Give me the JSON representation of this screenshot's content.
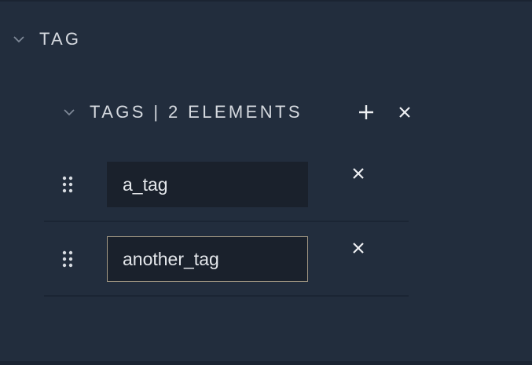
{
  "section": {
    "title": "TAG",
    "icon": "chevron-down-icon"
  },
  "tags": {
    "title": "TAGS | 2 ELEMENTS",
    "add_icon": "plus-icon",
    "clear_icon": "close-icon",
    "items": [
      {
        "value": "a_tag",
        "focused": false
      },
      {
        "value": "another_tag",
        "focused": true
      }
    ]
  },
  "colors": {
    "background": "#222d3d",
    "input_background": "#1a212c",
    "focus_border": "#a59a85",
    "text": "#d5d9df",
    "divider": "#1b2534"
  }
}
